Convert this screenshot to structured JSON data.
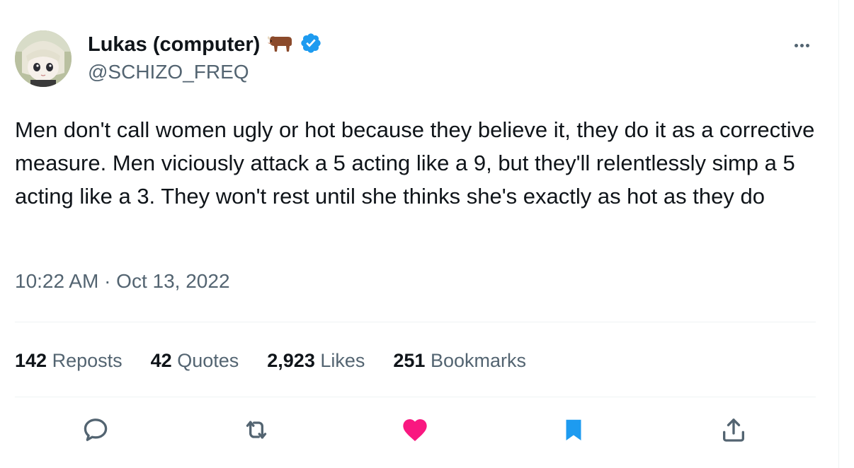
{
  "author": {
    "display_name": "Lukas (computer)",
    "name_emoji": "ox-emoji",
    "verified_badge": "verified-badge-icon",
    "handle": "@SCHIZO_FREQ",
    "avatar": "anime-avatar"
  },
  "tweet": {
    "text": "Men don't call women ugly or hot because they believe it, they do it as a corrective measure. Men viciously attack a 5 acting like a 9, but they'll relentlessly simp a 5 acting like a 3. They won't rest until she thinks she's exactly as hot as they do",
    "timestamp": "10:22 AM · Oct 13, 2022"
  },
  "stats": {
    "reposts": {
      "count": "142",
      "label": "Reposts"
    },
    "quotes": {
      "count": "42",
      "label": "Quotes"
    },
    "likes": {
      "count": "2,923",
      "label": "Likes"
    },
    "bookmarks": {
      "count": "251",
      "label": "Bookmarks"
    }
  },
  "actions": {
    "reply": "reply-icon",
    "repost": "repost-icon",
    "like": "heart-icon",
    "bookmark": "bookmark-icon",
    "share": "share-icon"
  },
  "colors": {
    "verified_blue": "#1d9bf0",
    "like_pink": "#f91880",
    "bookmark_blue": "#1d9bf0",
    "secondary_text": "#536471",
    "primary_text": "#0f1419"
  }
}
